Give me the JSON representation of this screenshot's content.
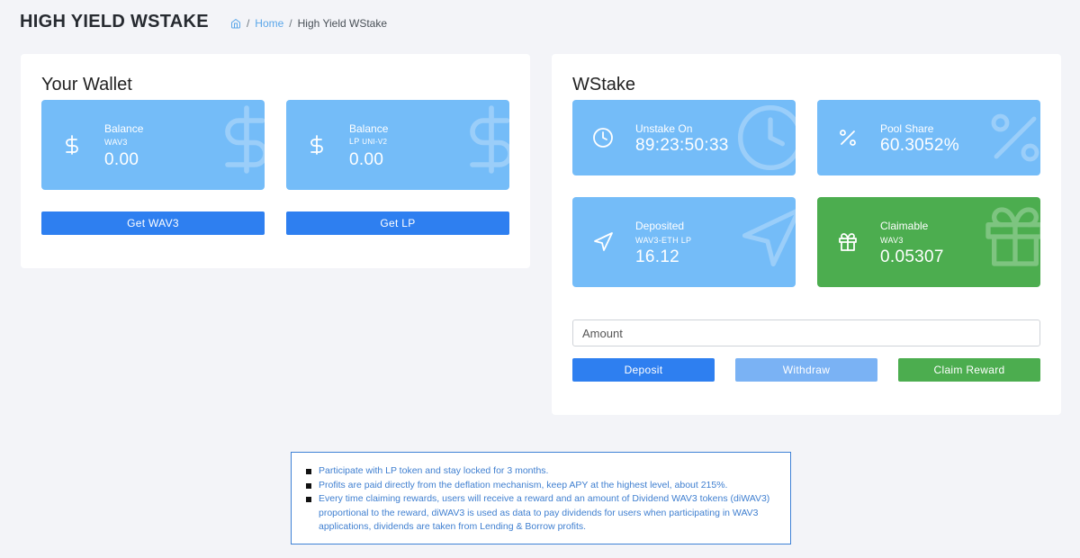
{
  "header": {
    "title": "HIGH YIELD WSTAKE"
  },
  "breadcrumb": {
    "home": "Home",
    "separator": "/",
    "current": "High Yield WStake",
    "home_icon": "home-icon"
  },
  "wallet": {
    "title": "Your Wallet",
    "tiles": [
      {
        "label": "Balance",
        "sub": "WAV3",
        "sub_small": "",
        "value": "0.00",
        "icon": "dollar-icon"
      },
      {
        "label": "Balance",
        "sub": "LP",
        "sub_small": "UNI-V2",
        "value": "0.00",
        "icon": "dollar-icon"
      }
    ],
    "buttons": {
      "get_wav3": "Get WAV3",
      "get_lp": "Get LP"
    }
  },
  "wstake": {
    "title": "WStake",
    "tiles": [
      {
        "label": "Unstake On",
        "sub": "",
        "value": "89:23:50:33",
        "icon": "clock-icon"
      },
      {
        "label": "Pool Share",
        "sub": "",
        "value": "60.3052%",
        "icon": "percent-icon"
      },
      {
        "label": "Deposited",
        "sub": "WAV3-ETH LP",
        "value": "16.12",
        "icon": "send-icon"
      },
      {
        "label": "Claimable",
        "sub": "WAV3",
        "value": "0.05307",
        "icon": "gift-icon"
      }
    ],
    "amount_placeholder": "Amount",
    "buttons": {
      "deposit": "Deposit",
      "withdraw": "Withdraw",
      "claim": "Claim Reward"
    }
  },
  "info": [
    "Participate with LP token and stay locked for 3 months.",
    "Profits are paid directly from the deflation mechanism, keep APY at the highest level, about 215%.",
    "Every time claiming rewards, users will receive a reward and an amount of Dividend WAV3 tokens (diWAV3) proportional to the reward, diWAV3 is used as data to pay dividends for users when participating in WAV3 applications, dividends are taken from Lending & Borrow profits."
  ],
  "colors": {
    "tile_blue": "#74bcf8",
    "tile_green": "#4cad4f",
    "primary": "#2e7ff0",
    "link": "#5aa6e9"
  }
}
